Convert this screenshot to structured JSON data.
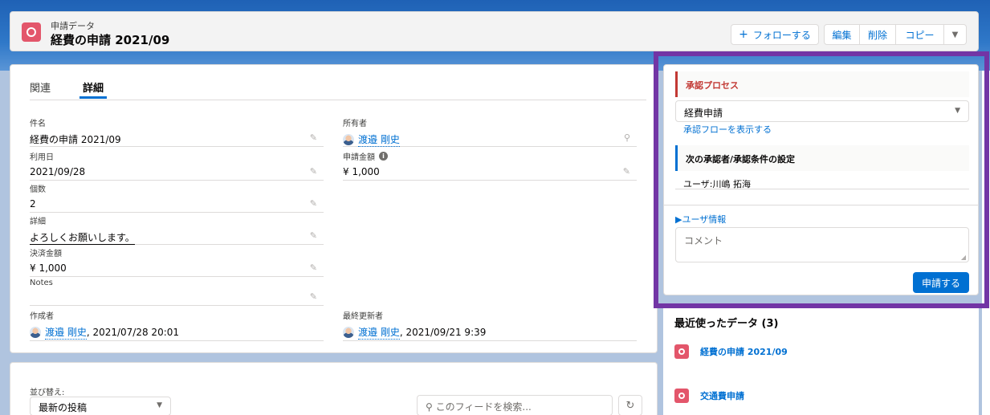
{
  "header": {
    "object_type": "申請データ",
    "record_title": "経費の申請 2021/09",
    "actions": {
      "follow": "フォローする",
      "edit": "編集",
      "delete": "削除",
      "copy": "コピー"
    }
  },
  "tabs": [
    "関連",
    "詳細"
  ],
  "fields": {
    "name": {
      "label": "件名",
      "value": "経費の申請 2021/09"
    },
    "owner": {
      "label": "所有者",
      "value": "渡邉 剛史"
    },
    "use_date": {
      "label": "利用日",
      "value": "2021/09/28"
    },
    "request_amount": {
      "label": "申請金額",
      "value": "¥ 1,000"
    },
    "count": {
      "label": "個数",
      "value": "2"
    },
    "details": {
      "label": "詳細",
      "value": "よろしくお願いします。"
    },
    "settled_amount": {
      "label": "決済金額",
      "value": "¥ 1,000"
    },
    "notes": {
      "label": "Notes",
      "value": ""
    },
    "created_by": {
      "label": "作成者",
      "user": "渡邉 剛史",
      "date": ", 2021/07/28 20:01"
    },
    "modified_by": {
      "label": "最終更新者",
      "user": "渡邉 剛史",
      "date": ", 2021/09/21 9:39"
    }
  },
  "feed": {
    "sort_label": "並び替え:",
    "sort_value": "最新の投稿",
    "search_placeholder": "このフィードを検索..."
  },
  "approval": {
    "section_title": "承認プロセス",
    "process_value": "経費申請",
    "show_flow_link": "承認フローを表示する",
    "next_approver_title": "次の承認者/承認条件の設定",
    "approver": "ユーザ:川嶋 拓海",
    "user_info_link": "▶ユーザ情報",
    "comment_placeholder": "コメント",
    "submit_label": "申請する"
  },
  "recent": {
    "title": "最近使ったデータ (3)",
    "items": [
      "経費の申請 2021/09",
      "交通費申請"
    ]
  },
  "colors": {
    "brand_blue": "#0070d2",
    "object_icon": "#e3566b",
    "highlight_frame": "#7235a5",
    "approval_accent": "#c23934"
  }
}
